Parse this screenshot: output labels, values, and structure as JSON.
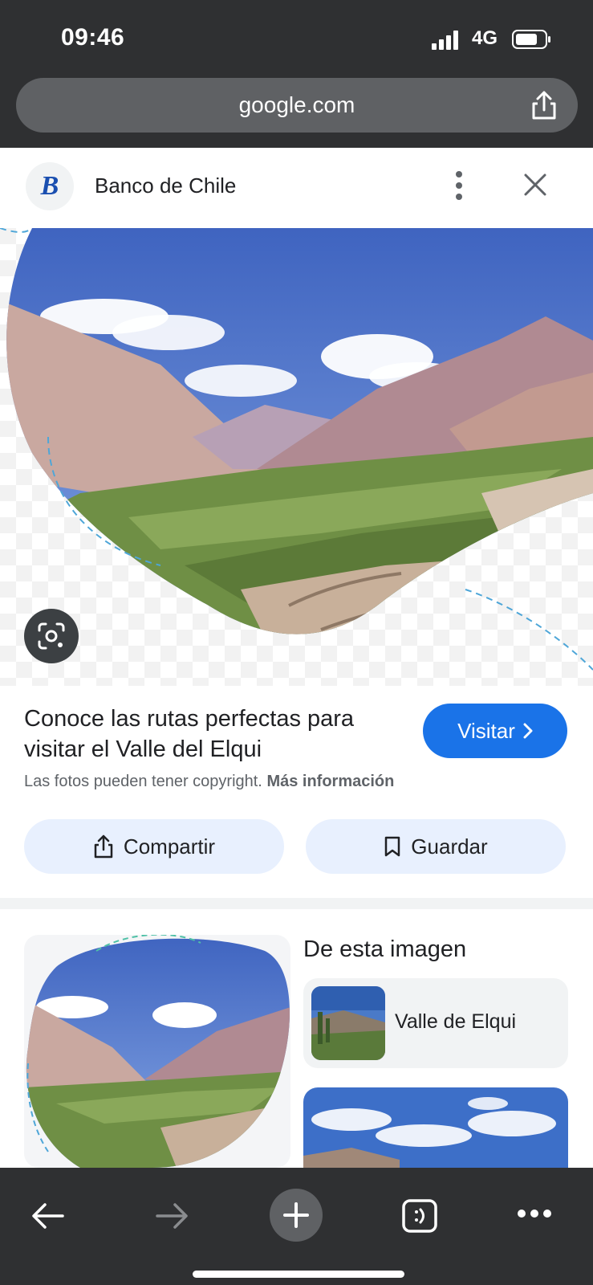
{
  "status_bar": {
    "time": "09:46",
    "network": "4G"
  },
  "browser": {
    "url": "google.com"
  },
  "source": {
    "logo_letter": "B",
    "name": "Banco de Chile"
  },
  "result": {
    "title": "Conoce las rutas perfectas para visitar el Valle del Elqui",
    "visit_label": "Visitar",
    "copyright_text": "Las fotos pueden tener copyright.",
    "more_info_link": "Más información",
    "share_label": "Compartir",
    "save_label": "Guardar"
  },
  "related": {
    "section_title": "De esta imagen",
    "items": [
      {
        "label": "Valle de Elqui"
      }
    ]
  },
  "colors": {
    "browser_chrome": "#2f3032",
    "accent_blue": "#1a73e8",
    "action_button_bg": "#e8f0fe"
  },
  "icons": [
    "signal-icon",
    "battery-icon",
    "share-icon",
    "more-vert-icon",
    "close-icon",
    "lens-icon",
    "chevron-right-icon",
    "bookmark-icon",
    "back-arrow-icon",
    "forward-arrow-icon",
    "plus-icon",
    "tabs-icon",
    "more-horiz-icon"
  ]
}
